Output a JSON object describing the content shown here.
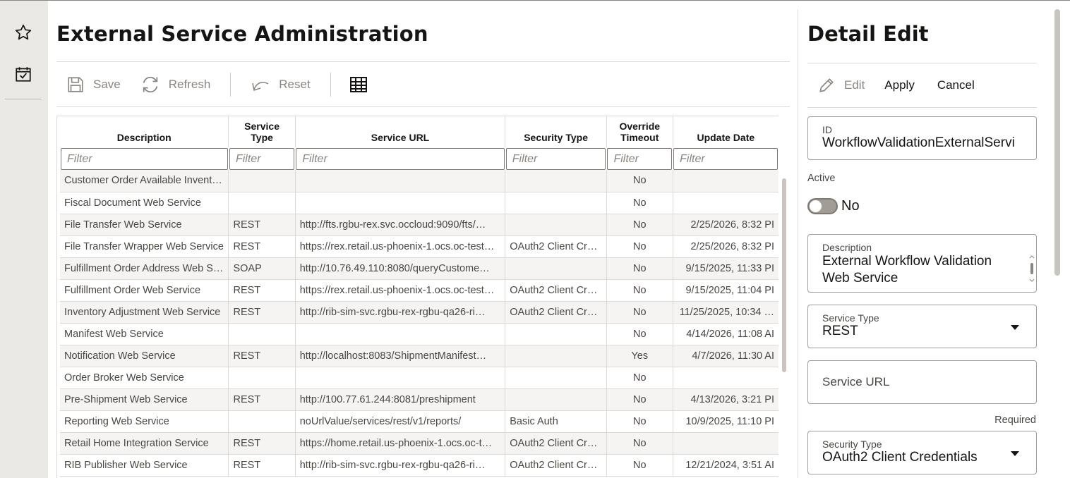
{
  "rail": {
    "items": [
      {
        "icon": "star-icon"
      },
      {
        "icon": "task-check-icon"
      }
    ]
  },
  "page": {
    "title": "External Service Administration"
  },
  "toolbar": {
    "save": "Save",
    "refresh": "Refresh",
    "reset": "Reset"
  },
  "table": {
    "columns": [
      "Description",
      "Service Type",
      "Service URL",
      "Security Type",
      "Override Timeout",
      "Update Date"
    ],
    "filter_placeholder": "Filter",
    "rows": [
      [
        "Customer Order Available Invent…",
        "",
        "",
        "",
        "No",
        ""
      ],
      [
        "Fiscal Document Web Service",
        "",
        "",
        "",
        "No",
        ""
      ],
      [
        "File Transfer Web Service",
        "REST",
        "http://fts.rgbu-rex.svc.occloud:9090/fts/…",
        "",
        "No",
        "2/25/2026, 8:32 PI"
      ],
      [
        "File Transfer Wrapper Web Service",
        "REST",
        "https://rex.retail.us-phoenix-1.ocs.oc-test…",
        "OAuth2 Client Cr…",
        "No",
        "2/25/2026, 8:32 PI"
      ],
      [
        "Fulfillment Order Address Web S…",
        "SOAP",
        "http://10.76.49.110:8080/queryCustome…",
        "",
        "No",
        "9/15/2025, 11:33 PI"
      ],
      [
        "Fulfillment Order Web Service",
        "REST",
        "https://rex.retail.us-phoenix-1.ocs.oc-test…",
        "OAuth2 Client Cr…",
        "No",
        "9/15/2025, 11:04 PI"
      ],
      [
        "Inventory Adjustment Web Service",
        "REST",
        "http://rib-sim-svc.rgbu-rex-rgbu-qa26-ri…",
        "OAuth2 Client Cr…",
        "No",
        "11/25/2025, 10:34 …"
      ],
      [
        "Manifest Web Service",
        "",
        "",
        "",
        "No",
        "4/14/2026, 11:08 AI"
      ],
      [
        "Notification Web Service",
        "REST",
        "http://localhost:8083/ShipmentManifest…",
        "",
        "Yes",
        "4/7/2026, 11:30 AI"
      ],
      [
        "Order Broker Web Service",
        "",
        "",
        "",
        "No",
        ""
      ],
      [
        "Pre-Shipment Web Service",
        "REST",
        "http://100.77.61.244:8081/preshipment",
        "",
        "No",
        "4/13/2026, 3:21 PI"
      ],
      [
        "Reporting Web Service",
        "",
        "noUrlValue/services/rest/v1/reports/",
        "Basic Auth",
        "No",
        "10/9/2025, 11:10 PI"
      ],
      [
        "Retail Home Integration Service",
        "REST",
        "https://home.retail.us-phoenix-1.ocs.oc-t…",
        "OAuth2 Client Cr…",
        "No",
        ""
      ],
      [
        "RIB Publisher Web Service",
        "REST",
        "http://rib-sim-svc.rgbu-rex-rgbu-qa26-ri…",
        "OAuth2 Client Cr…",
        "No",
        "12/21/2024, 3:51 AI"
      ]
    ]
  },
  "detail": {
    "title": "Detail Edit",
    "edit": "Edit",
    "apply": "Apply",
    "cancel": "Cancel",
    "id_label": "ID",
    "id_value": "WorkflowValidationExternalServi",
    "active_label": "Active",
    "active_value": "No",
    "desc_label": "Description",
    "desc_line1": "External Workflow Validation",
    "desc_line2": "Web Service",
    "stype_label": "Service Type",
    "stype_value": "REST",
    "url_label": "Service URL",
    "url_required": "Required",
    "sec_label": "Security Type",
    "sec_value": "OAuth2 Client Credentials"
  }
}
